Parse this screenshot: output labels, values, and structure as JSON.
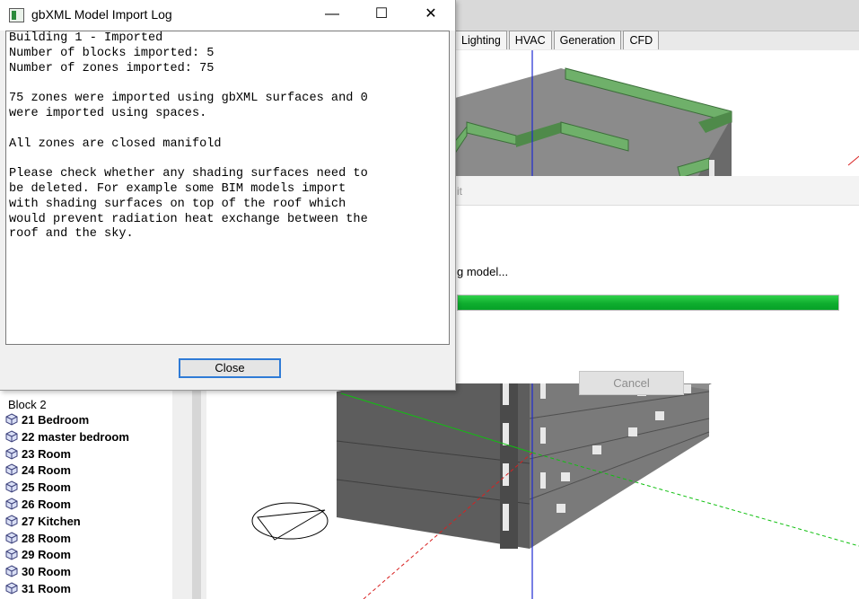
{
  "log_window": {
    "title": "gbXML Model Import Log",
    "controls": {
      "minimize": "—",
      "maximize": "☐",
      "close": "✕"
    },
    "lines": [
      "Building 1 - Imported",
      "Number of blocks imported: 5",
      "Number of zones imported: 75",
      "",
      "75 zones were imported using gbXML surfaces and 0",
      "were imported using spaces.",
      "",
      "All zones are closed manifold",
      "",
      "Please check whether any shading surfaces need to",
      "be deleted. For example some BIM models import",
      "with shading surfaces on top of the roof which",
      "would prevent radiation heat exchange between the",
      "roof and the sky."
    ],
    "close_label": "Close"
  },
  "tabs": [
    "Lighting",
    "HVAC",
    "Generation",
    "CFD"
  ],
  "progress_dialog": {
    "title_fragment": "it",
    "status_fragment": "g model...",
    "progress_fraction": 1.0,
    "cancel_label": "Cancel"
  },
  "tree": {
    "block_label": "Block 2",
    "items": [
      "21 Bedroom",
      "22 master bedroom",
      "23 Room",
      "24 Room",
      "25 Room",
      "26 Room",
      "27 Kitchen",
      "28 Room",
      "29 Room",
      "30 Room",
      "31 Room"
    ]
  },
  "colors": {
    "progress_green": "#0fae2f",
    "roof_trim_green": "#5f9e5a",
    "focus_blue": "#2f7bd6"
  },
  "icons": {
    "tree_item": "zone-cube-icon",
    "app": "app-window-icon"
  }
}
